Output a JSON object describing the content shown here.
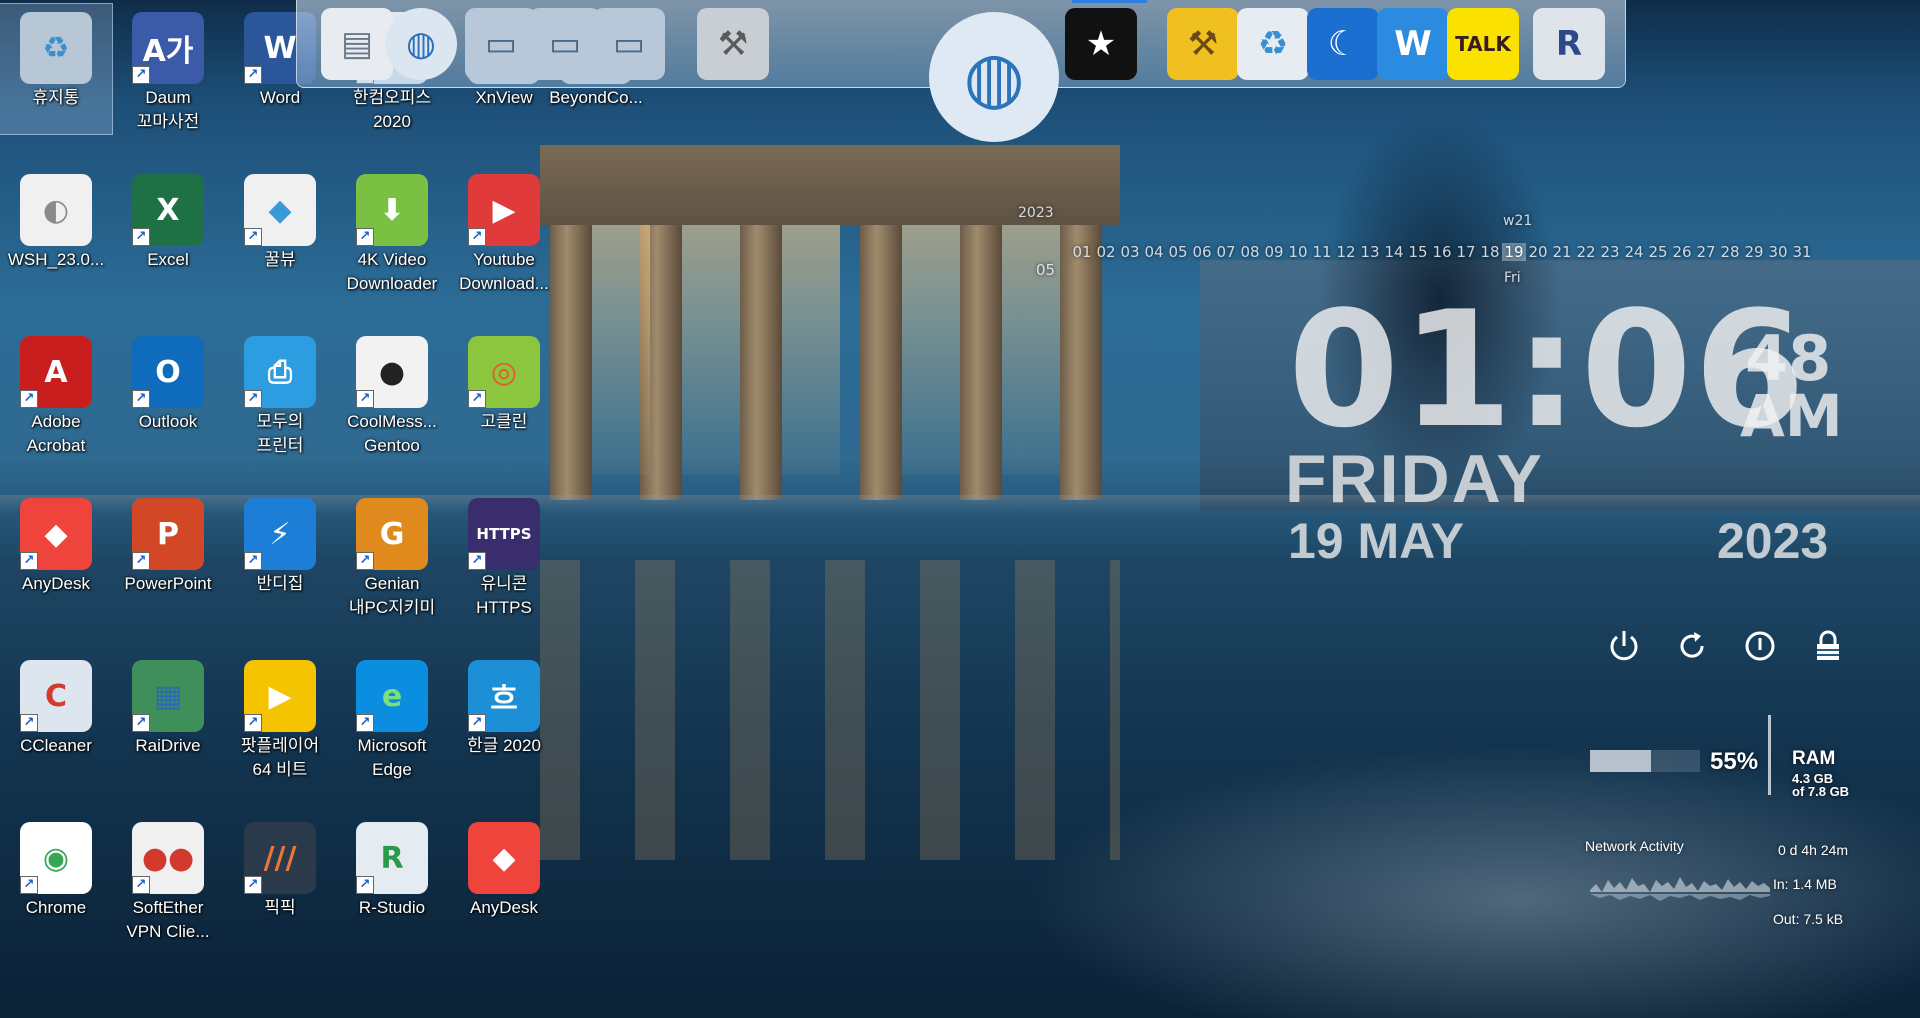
{
  "desktop": {
    "icons": [
      {
        "label": "휴지통",
        "glyph": "♻",
        "bg": "#b8c7d6",
        "fg": "#3a8fd0",
        "shortcut": false
      },
      {
        "label": "Daum\n꼬마사전",
        "glyph": "A가",
        "bg": "#3b5aa8",
        "fg": "#ffffff",
        "shortcut": true
      },
      {
        "label": "Word",
        "glyph": "W",
        "bg": "#2b579a",
        "fg": "#ffffff",
        "shortcut": true
      },
      {
        "label": "한컴오피스\n2020",
        "glyph": "◔",
        "bg": "#e9eef4",
        "fg": "#d0263a",
        "shortcut": true
      },
      {
        "label": "XnView",
        "glyph": "▭",
        "bg": "#c8d4e0",
        "fg": "#5a7090",
        "shortcut": false
      },
      {
        "label": "BeyondCo...",
        "glyph": "▭",
        "bg": "#c8d4e0",
        "fg": "#5a7090",
        "shortcut": false
      },
      {
        "label": "WSH_23.0...",
        "glyph": "◐",
        "bg": "#f0f0f0",
        "fg": "#8a8a8a",
        "shortcut": false
      },
      {
        "label": "Excel",
        "glyph": "X",
        "bg": "#1e7145",
        "fg": "#ffffff",
        "shortcut": true
      },
      {
        "label": "꿀뷰",
        "glyph": "◆",
        "bg": "#f0f0f0",
        "fg": "#3a9ad9",
        "shortcut": true
      },
      {
        "label": "4K Video\nDownloader",
        "glyph": "⬇",
        "bg": "#7ac143",
        "fg": "#ffffff",
        "shortcut": true
      },
      {
        "label": "Youtube\nDownload...",
        "glyph": "▶",
        "bg": "#e03a3a",
        "fg": "#ffffff",
        "shortcut": true
      },
      {
        "label": "Adobe\nAcrobat",
        "glyph": "A",
        "bg": "#c81e1e",
        "fg": "#ffffff",
        "shortcut": true
      },
      {
        "label": "Outlook",
        "glyph": "O",
        "bg": "#0f6cbd",
        "fg": "#ffffff",
        "shortcut": true
      },
      {
        "label": "모두의\n프린터",
        "glyph": "⎙",
        "bg": "#2b9de0",
        "fg": "#ffffff",
        "shortcut": true
      },
      {
        "label": "CoolMess...\nGentoo",
        "glyph": "●",
        "bg": "#f2f2f2",
        "fg": "#222222",
        "shortcut": true
      },
      {
        "label": "고클린",
        "glyph": "◎",
        "bg": "#8cc63f",
        "fg": "#e35b2a",
        "shortcut": true
      },
      {
        "label": "AnyDesk",
        "glyph": "◆",
        "bg": "#ef443b",
        "fg": "#ffffff",
        "shortcut": true
      },
      {
        "label": "PowerPoint",
        "glyph": "P",
        "bg": "#d24726",
        "fg": "#ffffff",
        "shortcut": true
      },
      {
        "label": "반디집",
        "glyph": "⚡",
        "bg": "#1c7ed6",
        "fg": "#ffffff",
        "shortcut": true
      },
      {
        "label": "Genian\n내PC지키미",
        "glyph": "G",
        "bg": "#e08a1e",
        "fg": "#ffffff",
        "shortcut": true
      },
      {
        "label": "유니콘\nHTTPS",
        "glyph": "HTTPS",
        "bg": "#3a2d6e",
        "fg": "#ffffff",
        "shortcut": true
      },
      {
        "label": "CCleaner",
        "glyph": "C",
        "bg": "#dde6ee",
        "fg": "#d23a2e",
        "shortcut": true
      },
      {
        "label": "RaiDrive",
        "glyph": "▦",
        "bg": "#3f8f5a",
        "fg": "#2b6cb0",
        "shortcut": true
      },
      {
        "label": "팟플레이어\n64 비트",
        "glyph": "▶",
        "bg": "#f5c400",
        "fg": "#ffffff",
        "shortcut": true
      },
      {
        "label": "Microsoft\nEdge",
        "glyph": "e",
        "bg": "#0c8ee0",
        "fg": "#7be07b",
        "shortcut": true
      },
      {
        "label": "한글 2020",
        "glyph": "흐",
        "bg": "#1c8fd6",
        "fg": "#ffffff",
        "shortcut": true
      },
      {
        "label": "Chrome",
        "glyph": "◉",
        "bg": "#ffffff",
        "fg": "#34a853",
        "shortcut": true
      },
      {
        "label": "SoftEther\nVPN Clie...",
        "glyph": "●●",
        "bg": "#f0f0f0",
        "fg": "#d23a2e",
        "shortcut": true
      },
      {
        "label": "픽픽",
        "glyph": "///",
        "bg": "#2a3a4a",
        "fg": "#e8783a",
        "shortcut": true
      },
      {
        "label": "R-Studio",
        "glyph": "R",
        "bg": "#e4ecf2",
        "fg": "#2a9a4a",
        "shortcut": true
      },
      {
        "label": "AnyDesk",
        "glyph": "◆",
        "bg": "#ef443b",
        "fg": "#ffffff",
        "shortcut": false
      }
    ]
  },
  "dock": {
    "items": [
      {
        "name": "documents-icon",
        "glyph": "▤",
        "bg": "#e8ecf0",
        "fg": "#6a7a8a"
      },
      {
        "name": "network-globe-icon",
        "glyph": "◍",
        "bg": "#dce6f0",
        "fg": "#2e6fb8"
      },
      {
        "name": "folder-icon",
        "glyph": "▭",
        "bg": "#b8c8d8",
        "fg": "#4a6a8a"
      },
      {
        "name": "folder-sync-icon",
        "glyph": "▭",
        "bg": "#b8c8d8",
        "fg": "#4a6a8a"
      },
      {
        "name": "folder-remote-icon",
        "glyph": "▭",
        "bg": "#b8c8d8",
        "fg": "#4a6a8a"
      },
      {
        "name": "tools-icon",
        "glyph": "⚒",
        "bg": "#c8ced4",
        "fg": "#5a5a5a"
      },
      {
        "name": "globe-pen-icon",
        "glyph": "◍",
        "bg": "#dfe9f3",
        "fg": "#2d73b9"
      },
      {
        "name": "tshirt-icon",
        "glyph": "★",
        "bg": "#111111",
        "fg": "#ffffff"
      },
      {
        "name": "hammer-wrench-icon",
        "glyph": "⚒",
        "bg": "#f0c020",
        "fg": "#6a4a1a"
      },
      {
        "name": "recycle-bin-icon",
        "glyph": "♻",
        "bg": "#e6ecf2",
        "fg": "#3a8fd0"
      },
      {
        "name": "moon-icon",
        "glyph": "☾",
        "bg": "#1a6fd0",
        "fg": "#ffffff"
      },
      {
        "name": "shield-w-icon",
        "glyph": "W",
        "bg": "#2a8be0",
        "fg": "#ffffff"
      },
      {
        "name": "kakaotalk-icon",
        "glyph": "TALK",
        "bg": "#fae100",
        "fg": "#3a1d1d"
      },
      {
        "name": "registry-icon",
        "glyph": "R",
        "bg": "#dfe4ea",
        "fg": "#2a4a8a"
      }
    ]
  },
  "calendar": {
    "year": "2023",
    "month": "05",
    "week": "w21",
    "day_name": "Fri",
    "days": [
      "01",
      "02",
      "03",
      "04",
      "05",
      "06",
      "07",
      "08",
      "09",
      "10",
      "11",
      "12",
      "13",
      "14",
      "15",
      "16",
      "17",
      "18",
      "19",
      "20",
      "21",
      "22",
      "23",
      "24",
      "25",
      "26",
      "27",
      "28",
      "29",
      "30",
      "31"
    ],
    "today": "19"
  },
  "clock": {
    "time": "01:06",
    "seconds": "48",
    "ampm": "AM",
    "weekday": "FRIDAY",
    "date": "19 MAY",
    "year": "2023"
  },
  "power": {
    "buttons": [
      {
        "name": "power-off-icon"
      },
      {
        "name": "restart-icon"
      },
      {
        "name": "standby-icon"
      },
      {
        "name": "lock-icon"
      }
    ]
  },
  "ram": {
    "percent": "55%",
    "fraction": 0.55,
    "label": "RAM",
    "used": "4.3 GB",
    "total": "of 7.8 GB"
  },
  "network": {
    "title": "Network Activity",
    "uptime": "0 d 4h 24m",
    "in": "In: 1.4 MB",
    "out": "Out: 7.5 kB"
  }
}
